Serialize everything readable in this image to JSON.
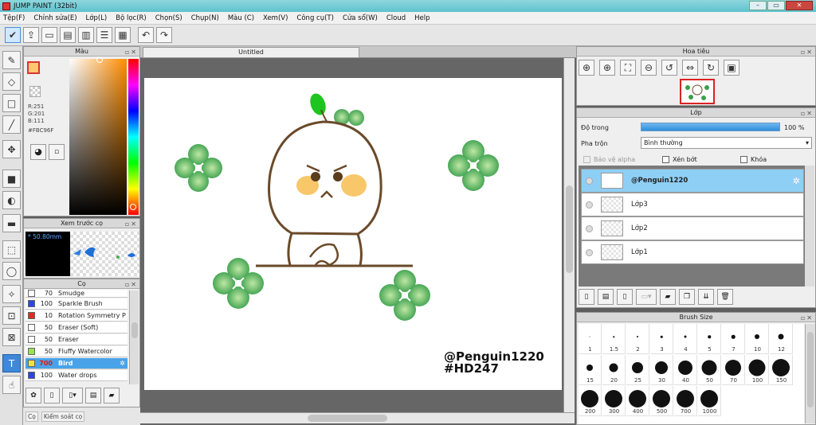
{
  "window": {
    "title": "JUMP PAINT (32bit)",
    "min": "–",
    "max": "▭",
    "close": "✕"
  },
  "menu": [
    "Tệp(F)",
    "Chỉnh sửa(E)",
    "Lớp(L)",
    "Bộ lọc(R)",
    "Chọn(S)",
    "Chụp(N)",
    "Màu (C)",
    "Xem(V)",
    "Công cụ(T)",
    "Cửa sổ(W)",
    "Cloud",
    "Help"
  ],
  "color_panel": {
    "title": "Màu",
    "r": "R:251",
    "g": "G:201",
    "b": "B:111",
    "hex": "#FBC96F",
    "fg_color": "#fbc96f"
  },
  "brush_preview": {
    "title": "Xem trước cọ",
    "size": "50.80mm"
  },
  "brush_panel": {
    "title": "Cọ",
    "items": [
      {
        "size": "70",
        "name": "Smudge",
        "color": "#ffffff"
      },
      {
        "size": "100",
        "name": "Sparkle Brush",
        "color": "#2f45e0"
      },
      {
        "size": "10",
        "name": "Rotation Symmetry P",
        "color": "#e02828"
      },
      {
        "size": "50",
        "name": "Eraser (Soft)",
        "color": "#ffffff"
      },
      {
        "size": "50",
        "name": "Eraser",
        "color": "#ffffff"
      },
      {
        "size": "50",
        "name": "Fluffy Watercolor",
        "color": "#9ee05a"
      },
      {
        "size": "700",
        "name": "Bird",
        "color": "#f2e33a"
      },
      {
        "size": "100",
        "name": "Water drops",
        "color": "#2f45e0"
      }
    ]
  },
  "status": {
    "left": "Cọ",
    "hint": "Kiểm soát cọ"
  },
  "canvas": {
    "tab": "Untitled",
    "watermark_line1": "@Penguin1220",
    "watermark_line2": "#HD247"
  },
  "navigator": {
    "title": "Hoa tiêu"
  },
  "layer_panel": {
    "title": "Lớp",
    "opacity_label": "Độ trong",
    "opacity_value": "100 %",
    "opacity": 1.0,
    "blend_label": "Pha trộn",
    "blend_value": "Bình thường",
    "protect_alpha": "Bảo vệ alpha",
    "clip": "Xén bớt",
    "lock": "Khóa",
    "layers": [
      "@Penguin1220",
      "Lớp3",
      "Lớp2",
      "Lớp1"
    ]
  },
  "brush_size_panel": {
    "title": "Brush Size",
    "sizes": [
      "1",
      "1.5",
      "2",
      "3",
      "4",
      "5",
      "7",
      "10",
      "12",
      "15",
      "20",
      "25",
      "30",
      "40",
      "50",
      "70",
      "100",
      "150",
      "200",
      "300",
      "400",
      "500",
      "700",
      "1000"
    ]
  }
}
